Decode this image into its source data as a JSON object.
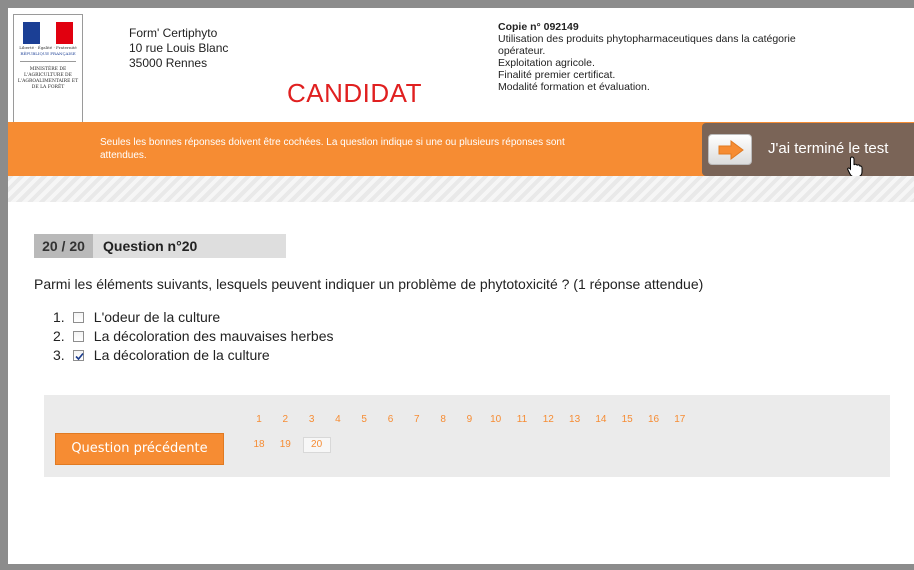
{
  "header": {
    "logo": {
      "motto": "Liberté · Égalité · Fraternité",
      "republic": "RÉPUBLIQUE FRANÇAISE",
      "ministry": "MINISTÈRE DE L'AGRICULTURE DE L'AGROALIMENTAIRE ET DE LA FORÊT"
    },
    "org_name": "Form' Certiphyto",
    "org_address1": "10 rue Louis Blanc",
    "org_address2": "35000 Rennes",
    "role_label": "CANDIDAT",
    "copie_number": "Copie n° 092149",
    "copie_line1": "Utilisation des produits phytopharmaceutiques dans la catégorie",
    "copie_line2": "opérateur.",
    "copie_line3": "Exploitation agricole.",
    "copie_line4": "Finalité premier certificat.",
    "copie_line5": "Modalité formation et évaluation."
  },
  "banner": {
    "instruction": "Seules les bonnes réponses doivent être cochées. La question indique si une ou plusieurs réponses sont attendues.",
    "finish_label": "J'ai terminé le test"
  },
  "question": {
    "counter": "20 / 20",
    "title": "Question n°20",
    "text": "Parmi les éléments suivants, lesquels peuvent indiquer un problème de phytotoxicité ? (1 réponse attendue)",
    "answers": [
      {
        "number": "1.",
        "label": "L'odeur de la culture",
        "checked": false
      },
      {
        "number": "2.",
        "label": "La décoloration des mauvaises herbes",
        "checked": false
      },
      {
        "number": "3.",
        "label": "La décoloration de la culture",
        "checked": true
      }
    ]
  },
  "navigation": {
    "prev_label": "Question précédente",
    "pages": [
      "1",
      "2",
      "3",
      "4",
      "5",
      "6",
      "7",
      "8",
      "9",
      "10",
      "11",
      "12",
      "13",
      "14",
      "15",
      "16",
      "17",
      "18",
      "19",
      "20"
    ],
    "current_page": "20"
  },
  "colors": {
    "accent": "#f68c33",
    "finish_button": "#7a6457",
    "role_label": "#e02020"
  },
  "icons": {
    "finish_arrow": "arrow-right-icon",
    "cursor": "hand-pointer-icon",
    "checkbox_checked": "checkmark-icon"
  }
}
